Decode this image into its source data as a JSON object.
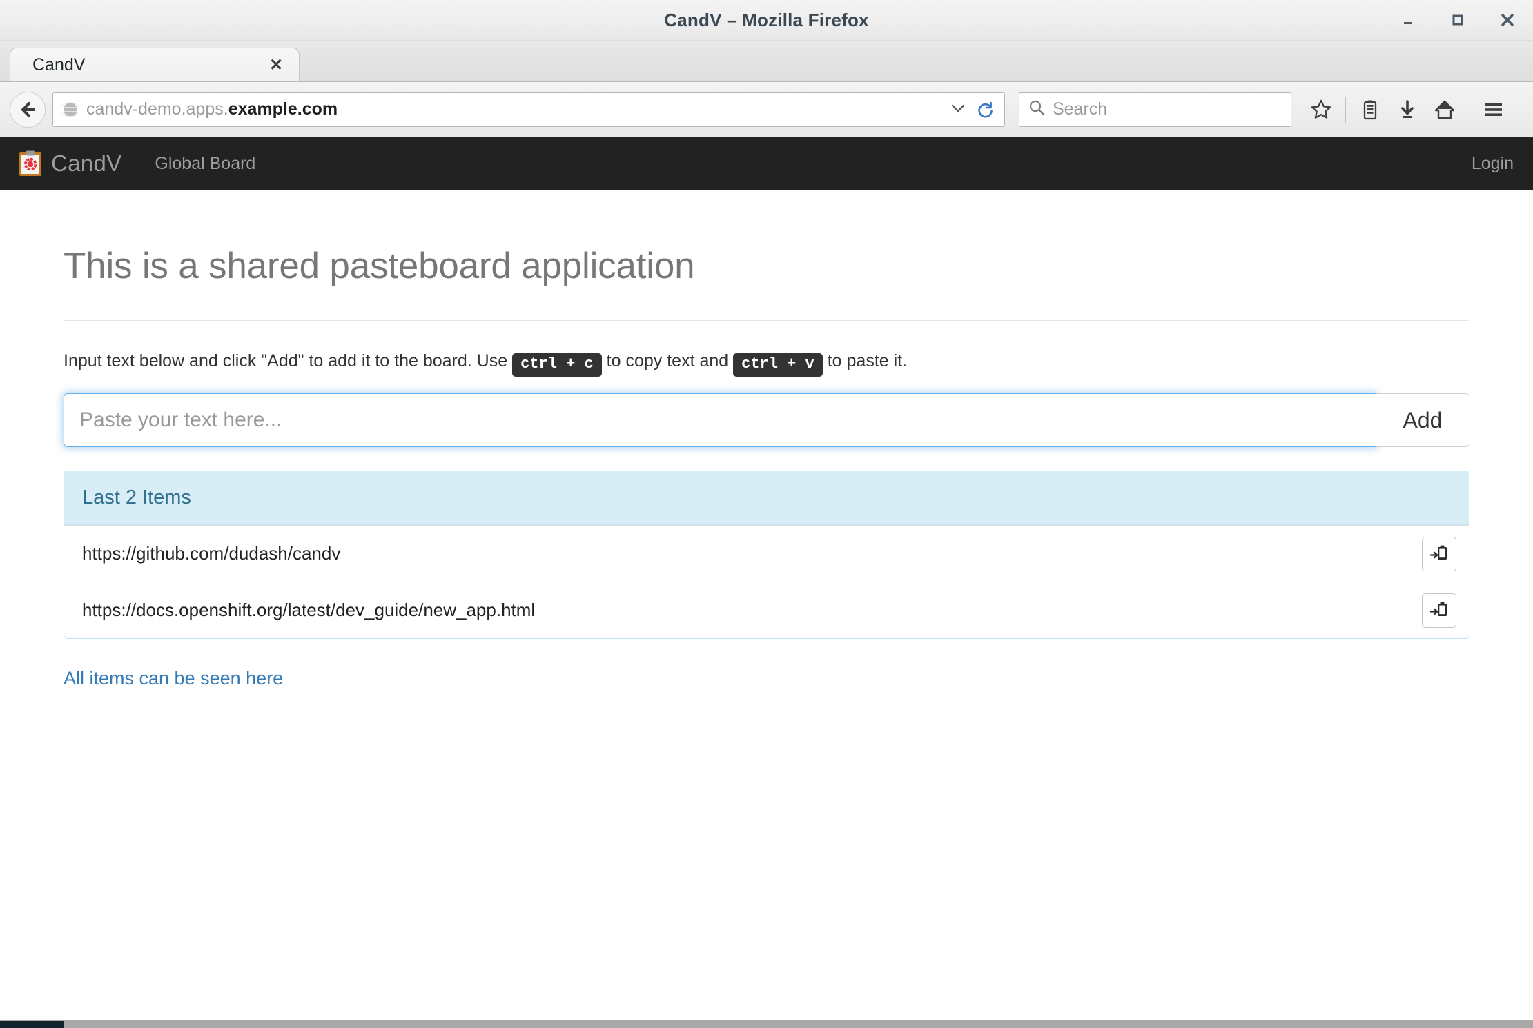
{
  "window": {
    "title": "CandV – Mozilla Firefox",
    "controls": {
      "minimize": "minimize",
      "maximize": "maximize",
      "close": "close"
    }
  },
  "browser": {
    "tab": {
      "label": "CandV",
      "close_label": "✕"
    },
    "new_tab_label": "+",
    "url": {
      "prefix": "candv-demo.apps.",
      "domain": "example.com",
      "caret": "⌄"
    },
    "search": {
      "placeholder": "Search"
    },
    "toolbar_icons": [
      "bookmark-star-icon",
      "library-icon",
      "downloads-icon",
      "home-icon",
      "menu-icon"
    ]
  },
  "app": {
    "brand": "CandV",
    "nav_items": [
      {
        "label": "Global Board"
      }
    ],
    "login_label": "Login"
  },
  "main": {
    "heading": "This is a shared pasteboard application",
    "lead": {
      "part1": "Input text below and click \"Add\" to add it to the board. Use",
      "kbd_copy": "ctrl + c",
      "part2": "to copy text and",
      "kbd_paste": "ctrl + v",
      "part3": "to paste it."
    },
    "input": {
      "value": "",
      "placeholder": "Paste your text here..."
    },
    "add_button": "Add",
    "panel": {
      "header": "Last 2 Items",
      "items": [
        {
          "text": "https://github.com/dudash/candv",
          "action_icon": "clipboard-paste-icon"
        },
        {
          "text": "https://docs.openshift.org/latest/dev_guide/new_app.html",
          "action_icon": "clipboard-paste-icon"
        }
      ]
    },
    "all_items_link": "All items can be seen here"
  },
  "colors": {
    "navbar_bg": "#222222",
    "panel_header_bg": "#d9edf7",
    "panel_border": "#bce8f1",
    "panel_header_text": "#31708f",
    "link": "#337ab7",
    "input_focus": "#66afe9"
  }
}
